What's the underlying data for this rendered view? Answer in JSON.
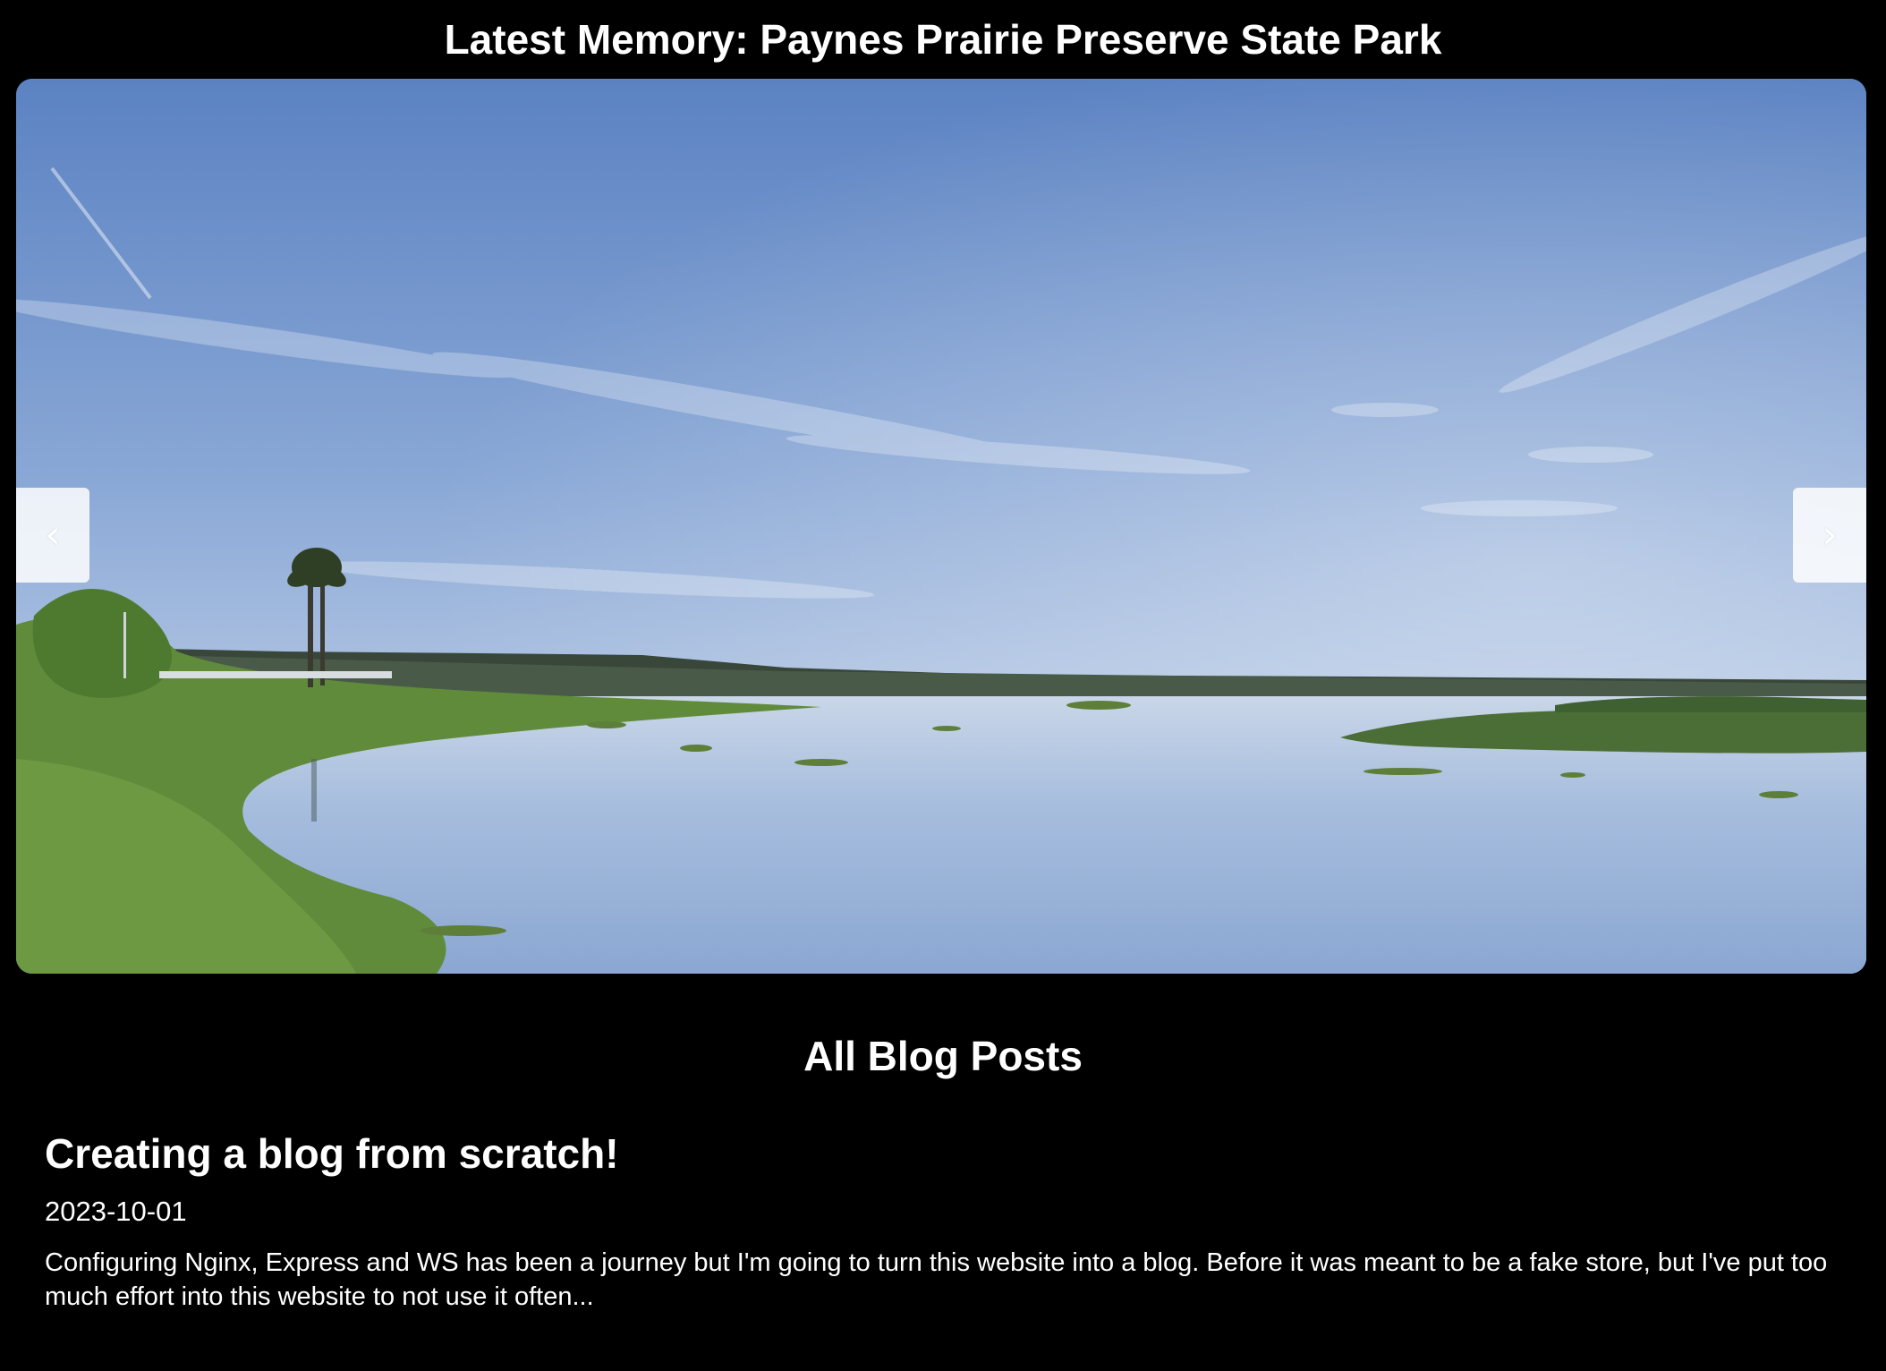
{
  "header": {
    "latest_memory_title": "Latest Memory: Paynes Prairie Preserve State Park"
  },
  "carousel": {
    "prev_label": "‹",
    "next_label": "›",
    "image_alt": "Paynes Prairie Preserve State Park"
  },
  "blog": {
    "section_title": "All Blog Posts",
    "posts": [
      {
        "title": "Creating a blog from scratch!",
        "date": "2023-10-01",
        "excerpt": "Configuring Nginx, Express and WS has been a journey but I'm going to turn this website into a blog. Before it was meant to be a fake store, but I've put too much effort into this website to not use it often..."
      }
    ]
  },
  "colors": {
    "background": "#000000",
    "text": "#ffffff",
    "sky_top": "#5a82c0",
    "water": "#a9bfdc",
    "vegetation": "#5f8a3a"
  }
}
